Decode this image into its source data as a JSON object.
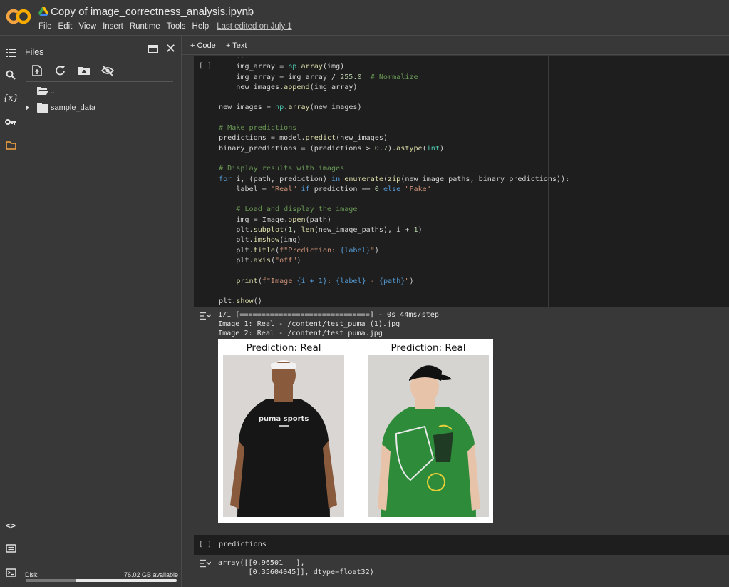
{
  "header": {
    "title": "Copy of image_correctness_analysis.ipynb",
    "menu": [
      "File",
      "Edit",
      "View",
      "Insert",
      "Runtime",
      "Tools",
      "Help"
    ],
    "last_edited": "Last edited on July 1",
    "logo_text": "CO"
  },
  "toolbar": {
    "code_label": "+ Code",
    "text_label": "+ Text"
  },
  "files_panel": {
    "title": "Files",
    "tree": [
      {
        "name": "..",
        "type": "parent"
      },
      {
        "name": "sample_data",
        "type": "folder"
      }
    ],
    "disk_label": "Disk",
    "disk_available": "76.02 GB available",
    "disk_usage_fraction": 0.33
  },
  "cell1": {
    "run_label": "[ ]",
    "code_lines": [
      "    img_array = np.array(img)",
      "    img_array = img_array / 255.0  # Normalize",
      "    new_images.append(img_array)",
      "",
      "new_images = np.array(new_images)",
      "",
      "# Make predictions",
      "predictions = model.predict(new_images)",
      "binary_predictions = (predictions > 0.7).astype(int)",
      "",
      "# Display results with images",
      "for i, (path, prediction) in enumerate(zip(new_image_paths, binary_predictions)):",
      "    label = \"Real\" if prediction == 0 else \"Fake\"",
      "",
      "    # Load and display the image",
      "    img = Image.open(path)",
      "    plt.subplot(1, len(new_image_paths), i + 1)",
      "    plt.imshow(img)",
      "    plt.title(f\"Prediction: {label}\")",
      "    plt.axis(\"off\")",
      "",
      "    print(f\"Image {i + 1}: {label} - {path}\")",
      "",
      "plt.show()"
    ],
    "output_lines": [
      "1/1 [==============================] - 0s 44ms/step",
      "Image 1: Real - /content/test_puma (1).jpg",
      "Image 2: Real - /content/test_puma.jpg"
    ],
    "figure": {
      "titles": [
        "Prediction: Real",
        "Prediction: Real"
      ],
      "shirt_text": "puma sports"
    }
  },
  "cell2": {
    "run_label": "[ ]",
    "code": "predictions",
    "output_lines": [
      "array([[0.96501   ],",
      "       [0.35604045]], dtype=float32)"
    ]
  },
  "colors": {
    "background": "#383838",
    "code_bg": "#1e1e1e",
    "accent": "#f5a442",
    "shirt1": "#161616",
    "shirt2": "#2e8b3a"
  }
}
